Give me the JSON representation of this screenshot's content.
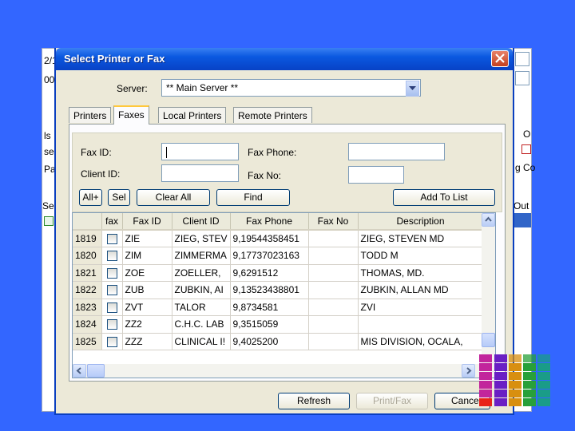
{
  "background_window": {
    "fragments": [
      "2/1",
      "00",
      "ls",
      "se",
      "Pa",
      "Sel",
      "O",
      "g Co",
      "Out"
    ]
  },
  "dialog": {
    "title": "Select Printer or Fax",
    "server": {
      "label": "Server:",
      "value": "** Main Server **"
    },
    "tabs": [
      "Printers",
      "Faxes",
      "Local Printers",
      "Remote Printers"
    ],
    "active_tab": "Faxes",
    "filters": {
      "fax_id": {
        "label": "Fax ID:",
        "value": ""
      },
      "client_id": {
        "label": "Client ID:",
        "value": ""
      },
      "fax_phone": {
        "label": "Fax Phone:",
        "value": ""
      },
      "fax_no": {
        "label": "Fax No:",
        "value": ""
      }
    },
    "buttons": {
      "all": "All+",
      "sel": "Sel",
      "clear_all": "Clear All",
      "find": "Find",
      "add_to_list": "Add To List"
    },
    "grid": {
      "columns": [
        "",
        "fax",
        "Fax ID",
        "Client ID",
        "Fax Phone",
        "Fax No",
        "Description"
      ],
      "rows": [
        {
          "num": "1819",
          "fax_id": "ZIE",
          "client_id": "ZIEG, STEV",
          "fax_phone": "9,19544358451",
          "fax_no": "",
          "description": "ZIEG, STEVEN MD"
        },
        {
          "num": "1820",
          "fax_id": "ZIM",
          "client_id": "ZIMMERMA",
          "fax_phone": "9,17737023163",
          "fax_no": "",
          "description": "TODD M"
        },
        {
          "num": "1821",
          "fax_id": "ZOE",
          "client_id": "ZOELLER,",
          "fax_phone": "9,6291512",
          "fax_no": "",
          "description": "THOMAS, MD."
        },
        {
          "num": "1822",
          "fax_id": "ZUB",
          "client_id": "ZUBKIN, AI",
          "fax_phone": "9,13523438801",
          "fax_no": "",
          "description": "ZUBKIN, ALLAN MD"
        },
        {
          "num": "1823",
          "fax_id": "ZVT",
          "client_id": "TALOR",
          "fax_phone": "9,8734581",
          "fax_no": "",
          "description": "ZVI"
        },
        {
          "num": "1824",
          "fax_id": "ZZ2",
          "client_id": "C.H.C. LAB",
          "fax_phone": "9,3515059",
          "fax_no": "",
          "description": ""
        },
        {
          "num": "1825",
          "fax_id": "ZZZ",
          "client_id": "CLINICAL I!",
          "fax_phone": "9,4025200",
          "fax_no": "",
          "description": "MIS DIVISION, OCALA,"
        }
      ]
    },
    "footer": {
      "refresh": "Refresh",
      "print_fax": "Print/Fax",
      "cancel": "Cance"
    }
  },
  "colors": {
    "desktop": "#3366ff",
    "title_bar": "#0a58e0",
    "dialog_face": "#ece9d8",
    "tab_highlight": "#ffc83c",
    "swatch_columns": [
      "#c2259c",
      "#6a1fc4",
      "#d88f10",
      "#28a03a",
      "#1a9c88"
    ],
    "swatch_bottom_left": "#e8241a"
  }
}
